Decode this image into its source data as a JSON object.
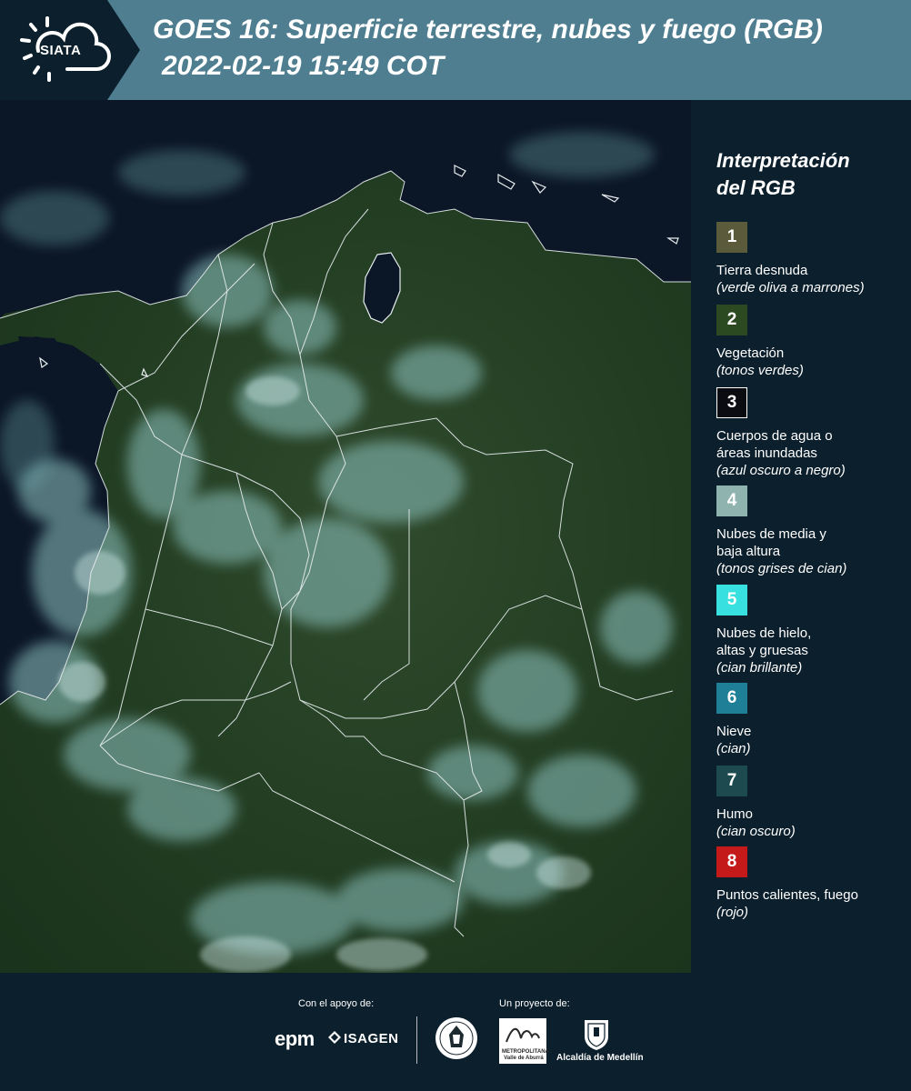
{
  "header": {
    "logo_text": "SIATA",
    "title": "GOES 16: Superficie terrestre, nubes y fuego (RGB)",
    "subtitle": "2022-02-19 15:49 COT"
  },
  "legend": {
    "title_line1": "Interpretación",
    "title_line2": "del RGB",
    "items": [
      {
        "number": "1",
        "color": "#5b5b3c",
        "label": "Tierra desnuda",
        "note": "(verde oliva a marrones)"
      },
      {
        "number": "2",
        "color": "#2c4a22",
        "label": "Vegetación",
        "note": "(tonos verdes)"
      },
      {
        "number": "3",
        "color": "#0b0b12",
        "label": "Cuerpos de agua o áreas inundadas",
        "note": "(azul oscuro a negro)"
      },
      {
        "number": "4",
        "color": "#8fb4b0",
        "label": "Nubes de media y baja altura",
        "note": "(tonos grises de cian)"
      },
      {
        "number": "5",
        "color": "#38e0e0",
        "label": "Nubes de hielo, altas y gruesas",
        "note": "(cian brillante)"
      },
      {
        "number": "6",
        "color": "#1e7f96",
        "label": "Nieve",
        "note": "(cian)"
      },
      {
        "number": "7",
        "color": "#1c4a4e",
        "label": "Humo",
        "note": "(cian oscuro)"
      },
      {
        "number": "8",
        "color": "#c41a1a",
        "label": "Puntos calientes, fuego",
        "note": "(rojo)"
      }
    ]
  },
  "footer": {
    "support_caption": "Con el apoyo de:",
    "project_caption": "Un proyecto de:",
    "sponsor_epm": "epm",
    "sponsor_isagen": "ISAGEN",
    "area_name": "METROPOLITANA",
    "area_sub": "Valle de Aburrá",
    "alcaldia": "Alcaldía de Medellín"
  }
}
